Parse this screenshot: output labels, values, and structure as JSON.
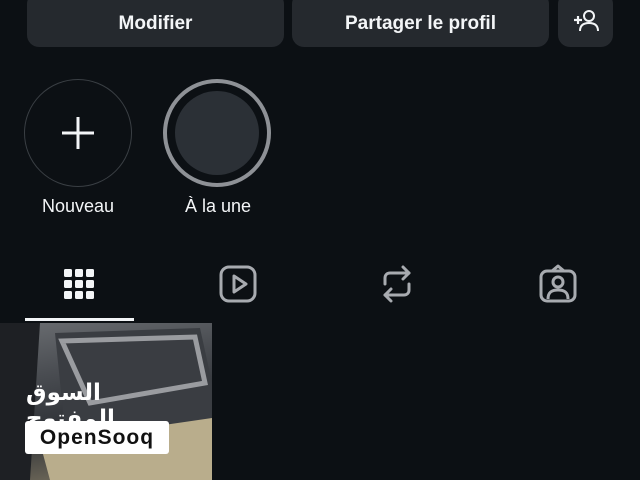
{
  "actions": {
    "edit_label": "Modifier",
    "share_label": "Partager le profil",
    "add_user_icon": "add-person-icon"
  },
  "highlights": [
    {
      "label": "Nouveau",
      "icon": "plus-icon"
    },
    {
      "label": "À la une",
      "icon": "highlight-cover"
    }
  ],
  "tabs": [
    {
      "name": "posts",
      "icon": "grid-icon",
      "selected": true
    },
    {
      "name": "reels",
      "icon": "reels-play-icon",
      "selected": false
    },
    {
      "name": "reposts",
      "icon": "repost-icon",
      "selected": false
    },
    {
      "name": "tagged",
      "icon": "tagged-person-icon",
      "selected": false
    }
  ],
  "posts": [
    {
      "watermark_arabic": "السوق المفتوح",
      "watermark_latin": "OpenSooq"
    }
  ],
  "colors": {
    "background": "#0c1014",
    "button": "#25292e",
    "text": "#f3f5f7",
    "ring": "#8e9196"
  }
}
